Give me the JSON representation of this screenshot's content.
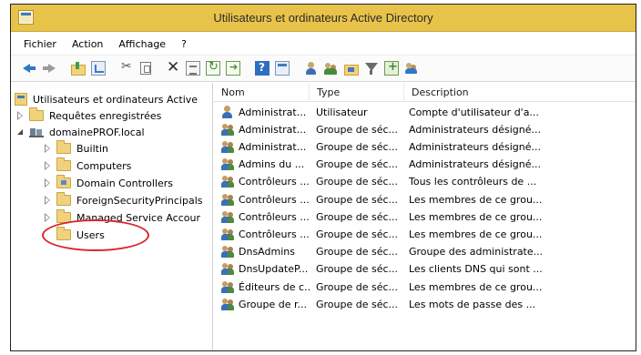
{
  "window": {
    "title": "Utilisateurs et ordinateurs Active Directory"
  },
  "menu": [
    "Fichier",
    "Action",
    "Affichage",
    "?"
  ],
  "toolbar": {
    "icons": [
      "back-arrow-icon",
      "forward-arrow-icon",
      "folder-up-icon",
      "show-tree-icon",
      "cut-icon",
      "copy-icon",
      "delete-icon",
      "properties-icon",
      "refresh-icon",
      "export-list-icon",
      "help-icon",
      "console-icon",
      "new-user-icon",
      "new-group-icon",
      "new-ou-icon",
      "filter-icon",
      "add-to-group-icon",
      "delegate-icon"
    ]
  },
  "tree": {
    "root": "Utilisateurs et ordinateurs Active",
    "items": [
      {
        "label": "Requêtes enregistrées"
      },
      {
        "label": "domainePROF.local"
      },
      {
        "label": "Builtin"
      },
      {
        "label": "Computers"
      },
      {
        "label": "Domain Controllers"
      },
      {
        "label": "ForeignSecurityPrincipals"
      },
      {
        "label": "Managed Service Accour"
      },
      {
        "label": "Users"
      }
    ]
  },
  "list": {
    "columns": [
      "Nom",
      "Type",
      "Description"
    ],
    "rows": [
      {
        "icon": "user-icon",
        "name": "Administrat...",
        "type": "Utilisateur",
        "description": "Compte d'utilisateur d'a..."
      },
      {
        "icon": "group-icon",
        "name": "Administrat...",
        "type": "Groupe de séc...",
        "description": "Administrateurs désigné..."
      },
      {
        "icon": "group-icon",
        "name": "Administrat...",
        "type": "Groupe de séc...",
        "description": "Administrateurs désigné..."
      },
      {
        "icon": "group-icon",
        "name": "Admins du ...",
        "type": "Groupe de séc...",
        "description": "Administrateurs désigné..."
      },
      {
        "icon": "group-icon",
        "name": "Contrôleurs ...",
        "type": "Groupe de séc...",
        "description": "Tous les contrôleurs de ..."
      },
      {
        "icon": "group-icon",
        "name": "Contrôleurs ...",
        "type": "Groupe de séc...",
        "description": "Les membres de ce grou..."
      },
      {
        "icon": "group-icon",
        "name": "Contrôleurs ...",
        "type": "Groupe de séc...",
        "description": "Les membres de ce grou..."
      },
      {
        "icon": "group-icon",
        "name": "Contrôleurs ...",
        "type": "Groupe de séc...",
        "description": "Les membres de ce grou..."
      },
      {
        "icon": "group-icon",
        "name": "DnsAdmins",
        "type": "Groupe de séc...",
        "description": "Groupe des administrate..."
      },
      {
        "icon": "group-icon",
        "name": "DnsUpdateP...",
        "type": "Groupe de séc...",
        "description": "Les clients DNS qui sont ..."
      },
      {
        "icon": "group-icon",
        "name": "Éditeurs de c...",
        "type": "Groupe de séc...",
        "description": "Les membres de ce grou..."
      },
      {
        "icon": "group-icon",
        "name": "Groupe de r...",
        "type": "Groupe de séc...",
        "description": "Les mots de passe des ..."
      }
    ]
  },
  "annotation": {
    "circle_color": "#d9262a"
  }
}
